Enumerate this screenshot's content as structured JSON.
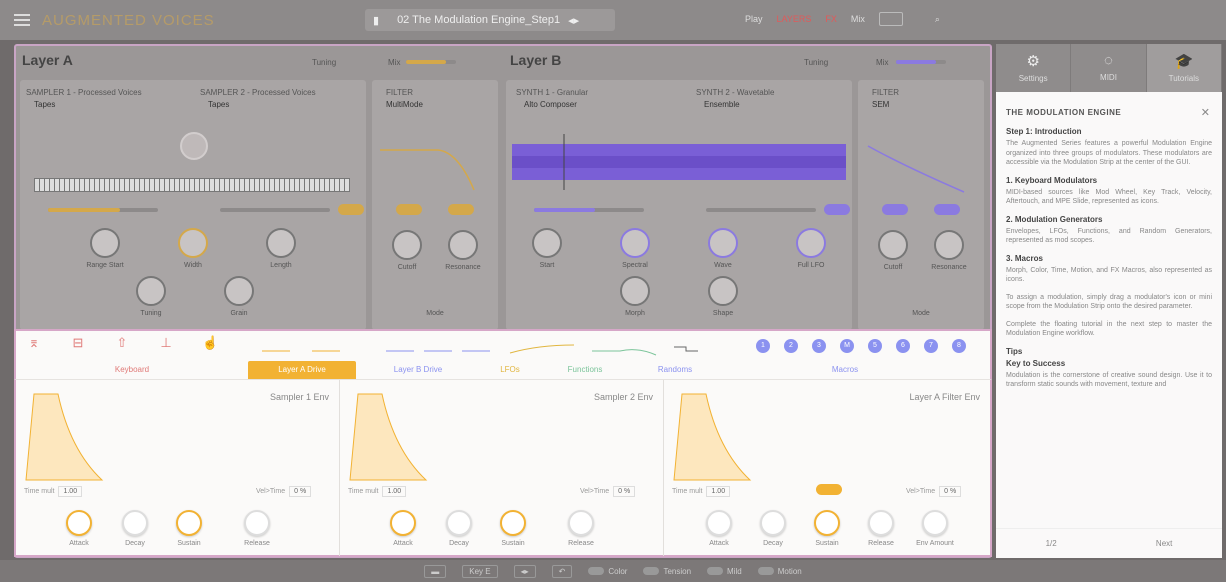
{
  "topbar": {
    "brand": "AUGMENTED VOICES",
    "preset_name": "02 The Modulation Engine_Step1",
    "play_label": "Play",
    "layers_label": "LAYERS",
    "fx_label": "FX",
    "mix_label": "Mix"
  },
  "layer_a": {
    "title": "Layer A",
    "tuning_label": "Tuning",
    "mix_label": "Mix",
    "sampler1": {
      "title": "SAMPLER 1 - Processed Voices",
      "preset": "Tapes"
    },
    "sampler2": {
      "title": "SAMPLER 2 - Processed Voices",
      "preset": "Tapes"
    },
    "filter": {
      "title": "FILTER",
      "type": "MultiMode"
    },
    "knobs": [
      "Range Start",
      "Width",
      "Length",
      "Tuning",
      "Grain"
    ],
    "filter_knobs": [
      "Cutoff",
      "Resonance",
      "Mode"
    ]
  },
  "layer_b": {
    "title": "Layer B",
    "tuning_label": "Tuning",
    "mix_label": "Mix",
    "synth1": {
      "title": "SYNTH 1 - Granular",
      "preset": "Alto Composer"
    },
    "synth2": {
      "title": "SYNTH 2 - Wavetable",
      "preset": "Ensemble"
    },
    "filter": {
      "title": "FILTER",
      "type": "SEM"
    },
    "knobs": [
      "Start",
      "Spectral",
      "Wave",
      "Full LFO",
      "Morph",
      "Shape"
    ],
    "filter_knobs": [
      "Cutoff",
      "Resonance",
      "Mode"
    ]
  },
  "mod_strip": {
    "tabs": [
      "Keyboard",
      "Layer A Drive",
      "Layer B Drive",
      "LFOs",
      "Functions",
      "Randoms",
      "Macros"
    ],
    "macros": [
      "1",
      "2",
      "3",
      "M",
      "5",
      "6",
      "7",
      "8"
    ],
    "colors": {
      "keyboard": "#e07a78",
      "layer_a": "#f2b233",
      "layer_b": "#8b92f0",
      "lfo": "#e1b640",
      "functions": "#7bc49a",
      "randoms": "#8b92f0"
    }
  },
  "envelopes": [
    {
      "name": "Sampler 1 Env",
      "time_mult_label": "Time mult",
      "time_mult": "1.00",
      "vel_time_label": "Vel>Time",
      "vel_time": "0 %",
      "knobs": [
        "Attack",
        "Decay",
        "Sustain",
        "Release"
      ]
    },
    {
      "name": "Sampler 2 Env",
      "time_mult_label": "Time mult",
      "time_mult": "1.00",
      "vel_time_label": "Vel>Time",
      "vel_time": "0 %",
      "knobs": [
        "Attack",
        "Decay",
        "Sustain",
        "Release"
      ]
    },
    {
      "name": "Layer A Filter Env",
      "time_mult_label": "Time mult",
      "time_mult": "1.00",
      "vel_time_label": "Vel>Time",
      "vel_time": "0 %",
      "knobs": [
        "Attack",
        "Decay",
        "Sustain",
        "Release",
        "Env Amount"
      ]
    }
  ],
  "sidepanel": {
    "tabs": [
      "Settings",
      "MIDI",
      "Tutorials"
    ],
    "tutorial": {
      "title": "THE MODULATION ENGINE",
      "step": "Step 1: Introduction",
      "intro": "The Augmented Series features a powerful Modulation Engine organized into three groups of modulators. These modulators are accessible via the Modulation Strip at the center of the GUI.",
      "s1_title": "1. Keyboard Modulators",
      "s1_text": "MIDI-based sources like Mod Wheel, Key Track, Velocity, Aftertouch, and MPE Slide, represented as icons.",
      "s2_title": "2. Modulation Generators",
      "s2_text": "Envelopes, LFOs, Functions, and Random Generators, represented as mod scopes.",
      "s3_title": "3. Macros",
      "s3_text": "Morph, Color, Time, Motion, and FX Macros, also represented as icons.",
      "assign_text": "To assign a modulation, simply drag a modulator's icon or mini scope from the Modulation Strip onto the desired parameter.",
      "complete_text": "Complete the floating tutorial in the next step to master the Modulation Engine workflow.",
      "tips_title": "Tips",
      "key_title": "Key to Success",
      "key_text": "Modulation is the cornerstone of creative sound design. Use it to transform static sounds with movement, texture and",
      "page": "1/2",
      "next": "Next"
    }
  },
  "bottombar": {
    "key_label": "Key E",
    "items": [
      "Color",
      "Tension",
      "Mild",
      "Motion"
    ]
  }
}
